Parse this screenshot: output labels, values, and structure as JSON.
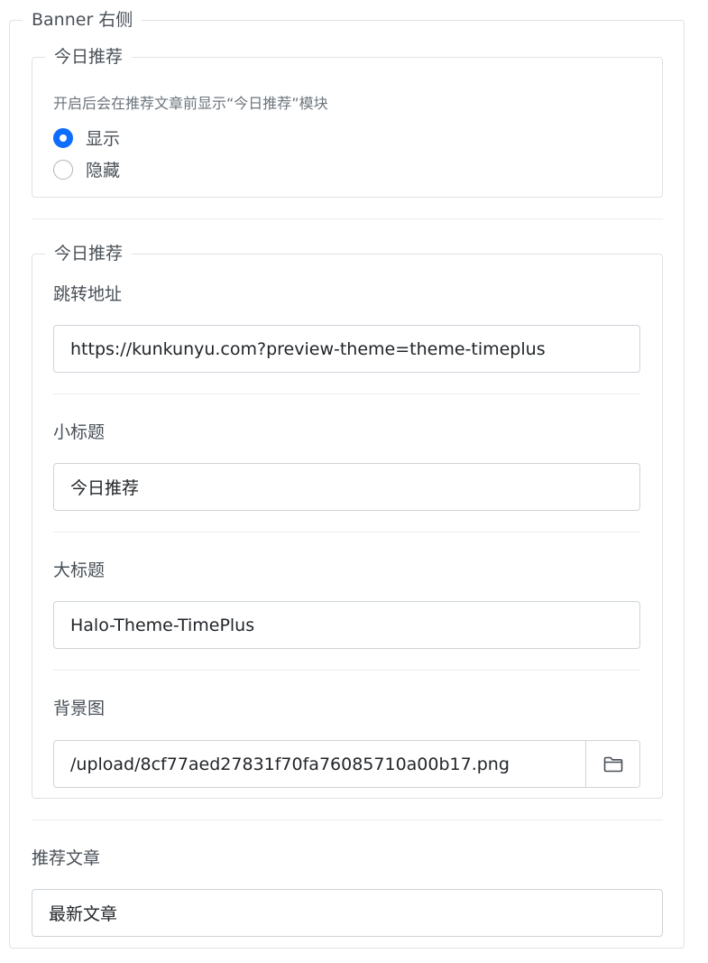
{
  "outer": {
    "legend": "Banner 右侧"
  },
  "section1": {
    "legend": "今日推荐",
    "help": "开启后会在推荐文章前显示“今日推荐”模块",
    "options": [
      {
        "label": "显示",
        "checked": true
      },
      {
        "label": "隐藏",
        "checked": false
      }
    ]
  },
  "section2": {
    "legend": "今日推荐",
    "jump": {
      "label": "跳转地址",
      "value": "https://kunkunyu.com?preview-theme=theme-timeplus"
    },
    "subtitle": {
      "label": "小标题",
      "value": "今日推荐"
    },
    "title": {
      "label": "大标题",
      "value": "Halo-Theme-TimePlus"
    },
    "background": {
      "label": "背景图",
      "value": "/upload/8cf77aed27831f70fa76085710a00b17.png",
      "button_icon": "folder-icon"
    }
  },
  "recommend": {
    "label": "推荐文章",
    "value": "最新文章"
  },
  "colors": {
    "accent": "#0d6efd",
    "border": "#dee2e6",
    "text": "#495057"
  }
}
